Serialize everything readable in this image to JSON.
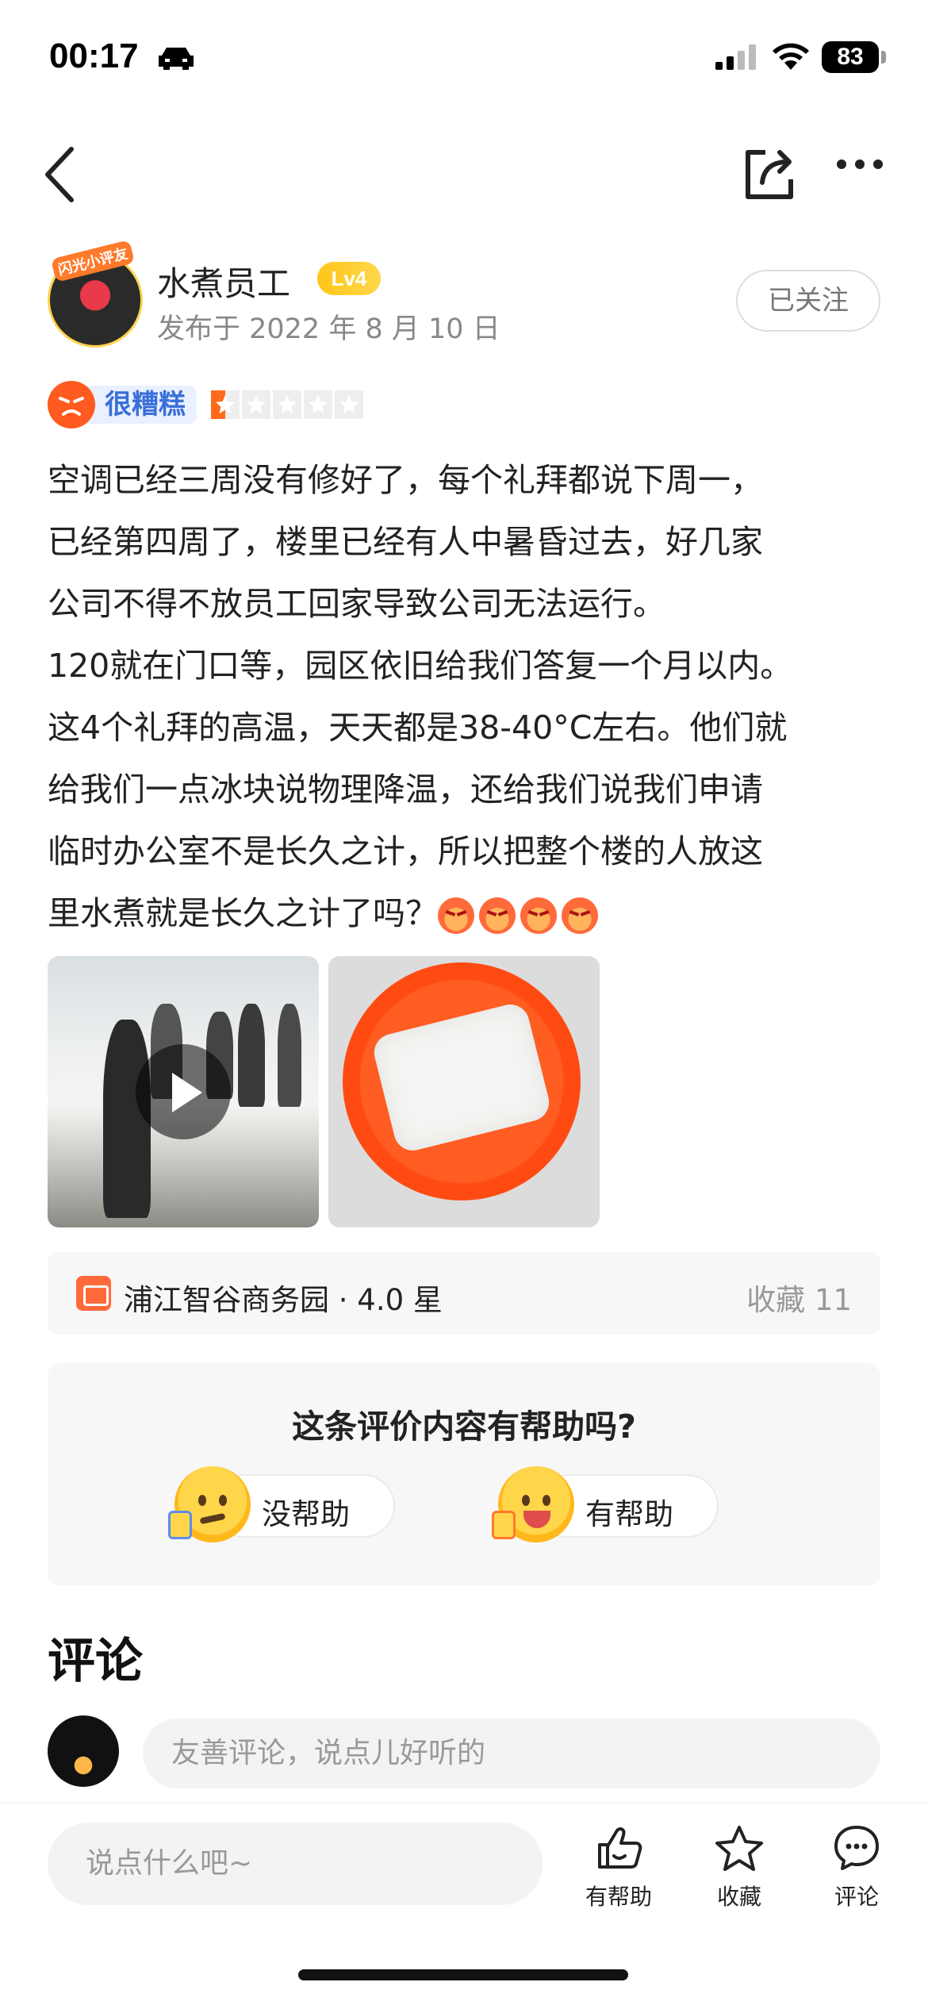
{
  "status_bar": {
    "time": "00:17",
    "battery": "83"
  },
  "nav": {
    "back_icon": "chevron-left-icon",
    "share_icon": "share-icon",
    "more_icon": "more-dots-icon"
  },
  "author": {
    "avatar_badge": "闪光小评友",
    "name": "水煮员工",
    "level": "Lv4",
    "publish_date": "发布于 2022 年 8 月 10 日",
    "follow_label": "已关注"
  },
  "rating": {
    "label": "很糟糕",
    "stars_total": 5,
    "stars_value": 0.5,
    "color": "#ff6a1a"
  },
  "review": {
    "lines": [
      "空调已经三周没有修好了，每个礼拜都说下周一，",
      "已经第四周了，楼里已经有人中暑昏过去，好几家",
      "公司不得不放员工回家导致公司无法运行。",
      "120就在门口等，园区依旧给我们答复一个月以内。",
      "这4个礼拜的高温，天天都是38-40°C左右。他们就",
      "给我们一点冰块说物理降温，还给我们说我们申请",
      "临时办公室不是长久之计，所以把整个楼的人放这",
      "里水煮就是长久之计了吗？"
    ],
    "emoji": [
      "angry-face-icon",
      "angry-face-icon",
      "angry-face-icon",
      "angry-face-icon"
    ]
  },
  "shop": {
    "name": "浦江智谷商务园 · 4.0 星",
    "favorites": "收藏 11"
  },
  "helpful": {
    "question": "这条评价内容有帮助吗?",
    "no_label": "没帮助",
    "yes_label": "有帮助"
  },
  "comments": {
    "title": "评论",
    "placeholder": "友善评论，说点儿好听的"
  },
  "bottom_bar": {
    "input_placeholder": "说点什么吧~",
    "helpful_label": "有帮助",
    "collect_label": "收藏",
    "comment_label": "评论"
  },
  "colors": {
    "accent_orange": "#ff6a1a",
    "rating_blue": "#3a6fd8",
    "level_yellow": "#ffc61a"
  }
}
